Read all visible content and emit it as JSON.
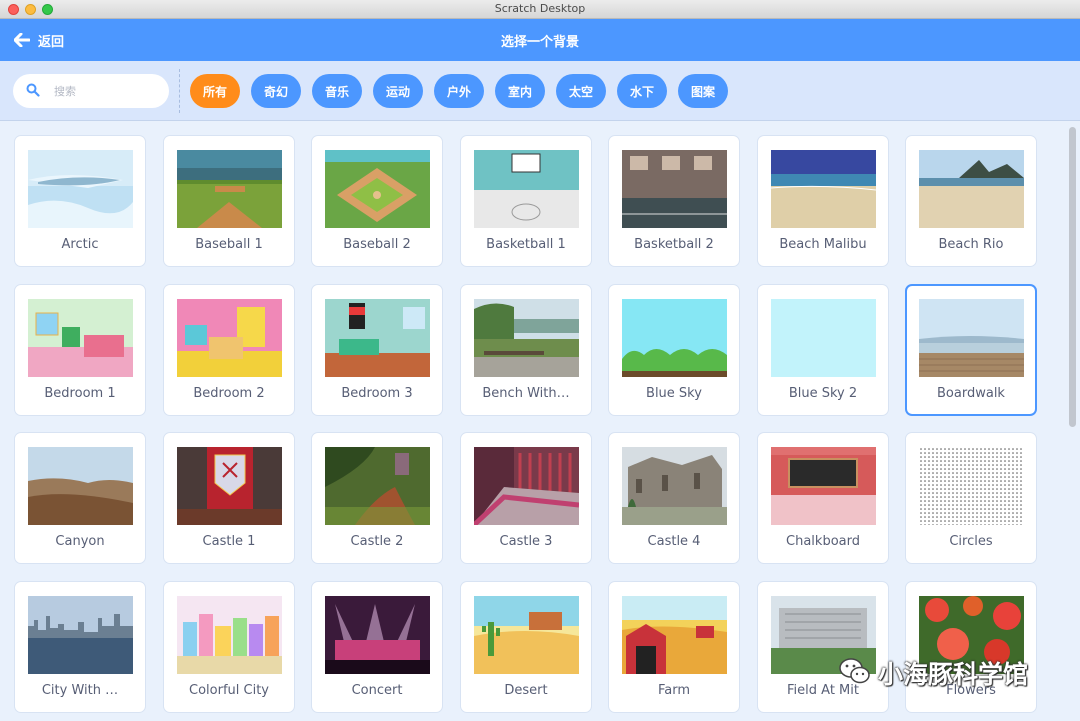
{
  "window": {
    "title": "Scratch Desktop"
  },
  "header": {
    "back_label": "返回",
    "title": "选择一个背景"
  },
  "search": {
    "placeholder": "搜索",
    "value": ""
  },
  "tags": [
    {
      "label": "所有",
      "active": true
    },
    {
      "label": "奇幻"
    },
    {
      "label": "音乐"
    },
    {
      "label": "运动"
    },
    {
      "label": "户外"
    },
    {
      "label": "室内"
    },
    {
      "label": "太空"
    },
    {
      "label": "水下"
    },
    {
      "label": "图案"
    }
  ],
  "backdrops": [
    {
      "name": "Arctic",
      "icon": "arctic-thumbnail"
    },
    {
      "name": "Baseball 1",
      "icon": "baseball-field-thumbnail"
    },
    {
      "name": "Baseball 2",
      "icon": "baseball-diamond-thumbnail"
    },
    {
      "name": "Basketball 1",
      "icon": "basketball-court-thumbnail"
    },
    {
      "name": "Basketball 2",
      "icon": "basketball-gym-thumbnail"
    },
    {
      "name": "Beach Malibu",
      "icon": "beach-thumbnail"
    },
    {
      "name": "Beach Rio",
      "icon": "beach-mountain-thumbnail"
    },
    {
      "name": "Bedroom 1",
      "icon": "bedroom-thumbnail"
    },
    {
      "name": "Bedroom 2",
      "icon": "bedroom-thumbnail"
    },
    {
      "name": "Bedroom 3",
      "icon": "bedroom-thumbnail"
    },
    {
      "name": "Bench With…",
      "icon": "bench-view-thumbnail"
    },
    {
      "name": "Blue Sky",
      "icon": "blue-sky-hills-thumbnail"
    },
    {
      "name": "Blue Sky 2",
      "icon": "blue-sky-plain-thumbnail"
    },
    {
      "name": "Boardwalk",
      "icon": "boardwalk-thumbnail",
      "selected": true
    },
    {
      "name": "Canyon",
      "icon": "canyon-thumbnail"
    },
    {
      "name": "Castle 1",
      "icon": "castle-hall-thumbnail"
    },
    {
      "name": "Castle 2",
      "icon": "castle-forest-thumbnail"
    },
    {
      "name": "Castle 3",
      "icon": "castle-corridor-thumbnail"
    },
    {
      "name": "Castle 4",
      "icon": "castle-ruins-thumbnail"
    },
    {
      "name": "Chalkboard",
      "icon": "chalkboard-thumbnail"
    },
    {
      "name": "Circles",
      "icon": "circles-pattern-thumbnail"
    },
    {
      "name": "City With …",
      "icon": "city-water-thumbnail"
    },
    {
      "name": "Colorful City",
      "icon": "colorful-city-thumbnail"
    },
    {
      "name": "Concert",
      "icon": "concert-stage-thumbnail"
    },
    {
      "name": "Desert",
      "icon": "desert-thumbnail"
    },
    {
      "name": "Farm",
      "icon": "farm-barn-thumbnail"
    },
    {
      "name": "Field At Mit",
      "icon": "field-building-thumbnail"
    },
    {
      "name": "Flowers",
      "icon": "flowers-thumbnail"
    }
  ],
  "watermark": {
    "text": "小海豚科学馆",
    "icon": "wechat-icon"
  },
  "colors": {
    "accent": "#4c97ff",
    "active_tag": "#ff8c1a",
    "label_text": "#575e75"
  }
}
